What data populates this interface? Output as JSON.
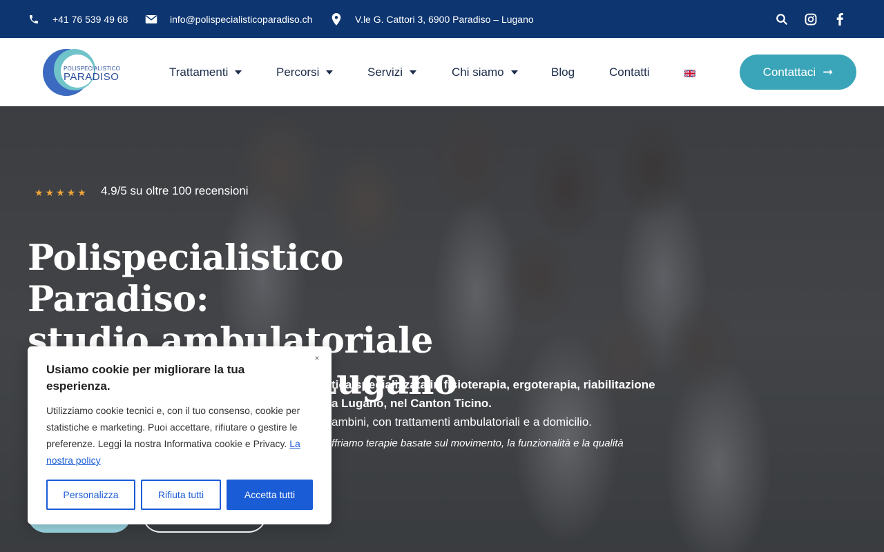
{
  "topbar": {
    "phone": "+41 76 539 49 68",
    "email": "info@polispecialisticoparadiso.ch",
    "address": "V.le G. Cattori 3, 6900 Paradiso – Lugano",
    "icons": [
      "phone-icon",
      "mail-icon",
      "location-pin-icon",
      "search-icon",
      "instagram-icon",
      "facebook-icon"
    ]
  },
  "logo": {
    "line1": "POLISPECIALISTICO",
    "line2": "PARADISO"
  },
  "nav": {
    "items": [
      {
        "label": "Trattamenti",
        "has_dropdown": true
      },
      {
        "label": "Percorsi",
        "has_dropdown": true
      },
      {
        "label": "Servizi",
        "has_dropdown": true
      },
      {
        "label": "Chi siamo",
        "has_dropdown": true
      },
      {
        "label": "Blog",
        "has_dropdown": false
      },
      {
        "label": "Contatti",
        "has_dropdown": false
      }
    ],
    "language_icon": "uk-flag-icon",
    "cta_label": "Contattaci"
  },
  "hero": {
    "rating_stars": 5,
    "rating_text": "4.9/5 su oltre 100 recensioni",
    "title_line1": "Polispecialistico Paradiso:",
    "title_line2": "studio ambulatoriale",
    "title_line3": "d’eccellenza a Lugano",
    "desc_line1": "tica specializzata in fisioterapia, ergoterapia, riabilitazione",
    "desc_line2": "a Lugano, nel Canton Ticino.",
    "desc_line3": "ambini, con trattamenti ambulatoriali e a domicilio.",
    "subtitle": "ffriamo terapie basate sul movimento, la funzionalità e la qualità"
  },
  "cookie": {
    "title": "Usiamo cookie per migliorare la tua esperienza.",
    "text": "Utilizziamo cookie tecnici e, con il tuo consenso, cookie per statistiche e marketing. Puoi accettare, rifiutare o gestire le preferenze. Leggi la nostra Informativa cookie e Privacy.",
    "link": "La nostra policy",
    "close": "×",
    "btn_customize": "Personalizza",
    "btn_reject": "Rifiuta tutti",
    "btn_accept": "Accetta tutti"
  },
  "colors": {
    "topbar_bg": "#0d3570",
    "cta_bg": "#3aa5b9",
    "star": "#f0a43a",
    "cookie_primary": "#1a5cd6"
  }
}
